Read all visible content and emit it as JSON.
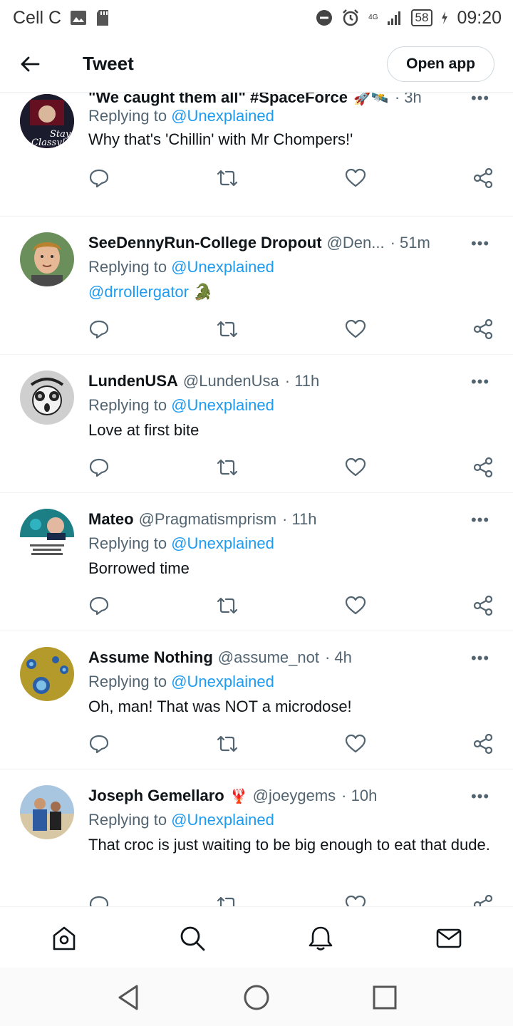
{
  "status_bar": {
    "carrier": "Cell C",
    "network_type": "4G",
    "battery": "58",
    "time": "09:20",
    "icons": [
      "image-icon",
      "sd-card-icon",
      "dnd-icon",
      "alarm-icon",
      "signal-icon",
      "battery-icon",
      "charging-icon"
    ]
  },
  "header": {
    "title": "Tweet",
    "open_app_label": "Open app"
  },
  "tweets": [
    {
      "name": "\"We caught them all\" #SpaceForce",
      "handle": "",
      "emoji": "🚀🛰️",
      "time": "· 3h",
      "replying_prefix": "Replying to",
      "replying_to": "@Unexplained",
      "text": "Why that's 'Chillin' with Mr Chompers!'",
      "avatar_text": "Stay Classy"
    },
    {
      "name": "SeeDennyRun-College Dropout",
      "handle": "@Den...",
      "emoji": "",
      "time": "· 51m",
      "replying_prefix": "Replying to",
      "replying_to": "@Unexplained",
      "text": "@drrollergator",
      "text_emoji": "🐊",
      "avatar_text": ""
    },
    {
      "name": "LundenUSA",
      "handle": "@LundenUsa",
      "emoji": "",
      "time": "· 11h",
      "replying_prefix": "Replying to",
      "replying_to": "@Unexplained",
      "text": "Love at first bite",
      "avatar_text": ""
    },
    {
      "name": "Mateo",
      "handle": "@Pragmatismprism",
      "emoji": "",
      "time": "· 11h",
      "replying_prefix": "Replying to",
      "replying_to": "@Unexplained",
      "text": "Borrowed time",
      "avatar_text": ""
    },
    {
      "name": "Assume Nothing",
      "handle": "@assume_not",
      "emoji": "",
      "time": "· 4h",
      "replying_prefix": "Replying to",
      "replying_to": "@Unexplained",
      "text": "Oh, man! That was NOT a microdose!",
      "avatar_text": ""
    },
    {
      "name": "Joseph Gemellaro",
      "handle": "@joeygems",
      "emoji": "🦞",
      "time": "· 10h",
      "replying_prefix": "Replying to",
      "replying_to": "@Unexplained",
      "text": "That croc is just waiting to be big enough to eat that dude.",
      "avatar_text": ""
    }
  ],
  "bottom_nav": [
    "home-icon",
    "search-icon",
    "notifications-icon",
    "messages-icon"
  ],
  "system_nav": [
    "back-triangle-icon",
    "home-circle-icon",
    "recents-square-icon"
  ],
  "colors": {
    "accent": "#1d9bf0",
    "text": "#0f1419",
    "secondary": "#536471",
    "divider": "#eff3f4"
  }
}
